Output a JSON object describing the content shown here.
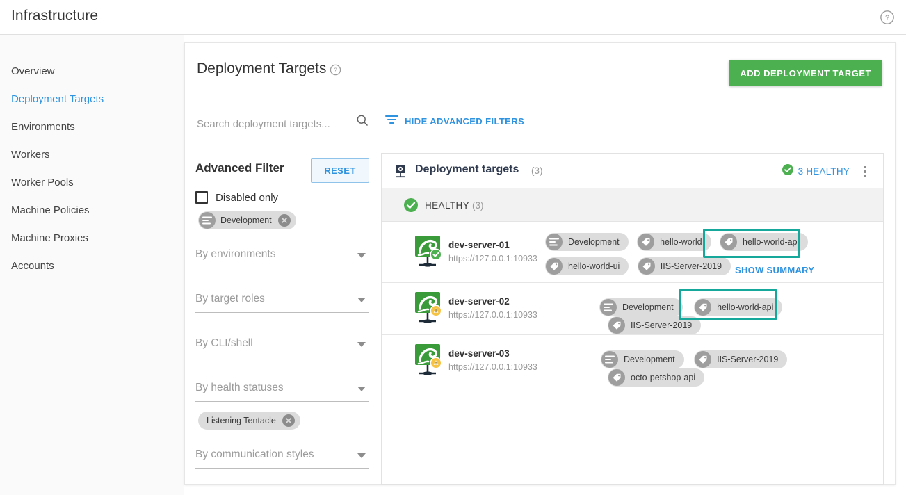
{
  "topbar": {
    "title": "Infrastructure",
    "help_icon": "help-circle-icon"
  },
  "sidebar": {
    "items": [
      {
        "label": "Overview",
        "active": false
      },
      {
        "label": "Deployment Targets",
        "active": true
      },
      {
        "label": "Environments",
        "active": false
      },
      {
        "label": "Workers",
        "active": false
      },
      {
        "label": "Worker Pools",
        "active": false
      },
      {
        "label": "Machine Policies",
        "active": false
      },
      {
        "label": "Machine Proxies",
        "active": false
      },
      {
        "label": "Accounts",
        "active": false
      }
    ]
  },
  "main": {
    "page_title": "Deployment Targets",
    "page_title_help_icon": "help-circle-icon",
    "add_button_label": "ADD DEPLOYMENT TARGET",
    "add_button_color": "#4caf50",
    "search": {
      "placeholder": "Search deployment targets...",
      "value": "",
      "icon": "search-icon"
    },
    "filters_toggle": {
      "label": "HIDE ADVANCED FILTERS",
      "icon": "filter-lines-icon",
      "color": "#2f93e0"
    }
  },
  "advanced_filter": {
    "title": "Advanced Filter",
    "reset_label": "RESET",
    "disabled_only": {
      "label": "Disabled only",
      "checked": false
    },
    "environment_chip": {
      "label": "Development",
      "icon": "environment-icon",
      "remove_icon": "close-icon"
    },
    "communication_chip": {
      "label": "Listening Tentacle",
      "remove_icon": "close-icon"
    },
    "selects": [
      {
        "placeholder": "By environments",
        "value": ""
      },
      {
        "placeholder": "By target roles",
        "value": ""
      },
      {
        "placeholder": "By CLI/shell",
        "value": ""
      },
      {
        "placeholder": "By health statuses",
        "value": ""
      },
      {
        "placeholder": "By communication styles",
        "value": ""
      }
    ]
  },
  "results": {
    "header": {
      "icon": "deployment-target-icon",
      "title": "Deployment targets",
      "count": "(3)",
      "health_label": "3 HEALTHY",
      "health_color": "#2f93e0",
      "health_icon": "check-circle-icon",
      "overflow_icon": "kebab-menu-icon"
    },
    "group": {
      "status_icon": "check-circle-icon",
      "label": "HEALTHY",
      "count": "(3)"
    },
    "rows": [
      {
        "name": "dev-server-01",
        "url": "https://127.0.0.1:10933",
        "machine_icon": "tentacle-machine-icon",
        "status_badge": "healthy-check-badge",
        "tags": [
          {
            "label": "Development",
            "icon": "environment-icon",
            "highlighted": false
          },
          {
            "label": "hello-world",
            "icon": "tag-icon",
            "highlighted": false
          },
          {
            "label": "hello-world-api",
            "icon": "tag-icon",
            "highlighted": true
          },
          {
            "label": "hello-world-ui",
            "icon": "tag-icon",
            "highlighted": false
          },
          {
            "label": "IIS-Server-2019",
            "icon": "tag-icon",
            "highlighted": false
          }
        ],
        "show_summary_label": "SHOW SUMMARY"
      },
      {
        "name": "dev-server-02",
        "url": "https://127.0.0.1:10933",
        "machine_icon": "tentacle-machine-icon",
        "status_badge": "warning-badge",
        "tags": [
          {
            "label": "Development",
            "icon": "environment-icon",
            "highlighted": false
          },
          {
            "label": "hello-world-api",
            "icon": "tag-icon",
            "highlighted": true
          },
          {
            "label": "IIS-Server-2019",
            "icon": "tag-icon",
            "highlighted": false
          }
        ],
        "show_summary_label": ""
      },
      {
        "name": "dev-server-03",
        "url": "https://127.0.0.1:10933",
        "machine_icon": "tentacle-machine-icon",
        "status_badge": "warning-badge",
        "tags": [
          {
            "label": "Development",
            "icon": "environment-icon",
            "highlighted": false
          },
          {
            "label": "IIS-Server-2019",
            "icon": "tag-icon",
            "highlighted": false
          },
          {
            "label": "octo-petshop-api",
            "icon": "tag-icon",
            "highlighted": false
          }
        ],
        "show_summary_label": ""
      }
    ],
    "highlight_color": "#16a89a"
  }
}
